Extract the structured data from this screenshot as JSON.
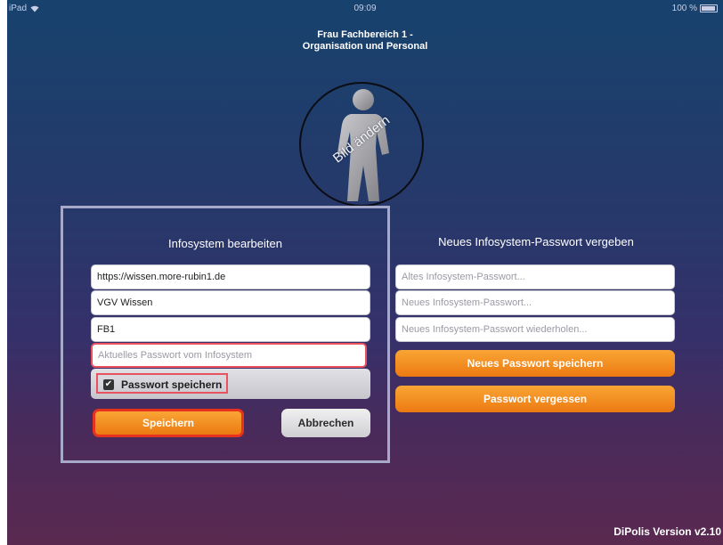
{
  "status_bar": {
    "device": "iPad",
    "time": "09:09",
    "battery": "100 %"
  },
  "user": {
    "name_line1": "Frau Fachbereich 1 -",
    "name_line2": "Organisation und Personal"
  },
  "avatar": {
    "label": "Bild ändern"
  },
  "edit_panel": {
    "title": "Infosystem bearbeiten",
    "url_value": "https://wissen.more-rubin1.de",
    "name_value": "VGV Wissen",
    "user_value": "FB1",
    "password_placeholder": "Aktuelles Passwort vom Infosystem",
    "save_password_label": "Passwort speichern",
    "save_password_checked": true,
    "save_button": "Speichern",
    "cancel_button": "Abbrechen"
  },
  "password_panel": {
    "title": "Neues Infosystem-Passwort vergeben",
    "old_password_placeholder": "Altes Infosystem-Passwort...",
    "new_password_placeholder": "Neues Infosystem-Passwort...",
    "repeat_password_placeholder": "Neues Infosystem-Passwort wiederholen...",
    "save_new_button": "Neues Passwort speichern",
    "forgot_button": "Passwort vergessen"
  },
  "footer": {
    "version": "DiPolis Version v2.10"
  },
  "colors": {
    "accent_orange": "#f18b1f",
    "highlight_red": "#e9535f",
    "background_top": "#17426d",
    "background_bottom": "#5a2950"
  }
}
